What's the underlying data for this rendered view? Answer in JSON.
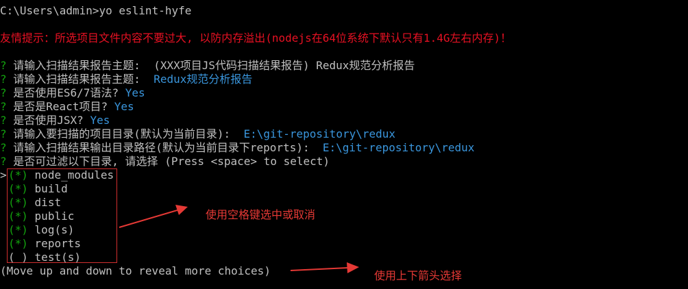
{
  "command": {
    "prompt": "C:\\Users\\admin>",
    "input": "yo eslint-hyfe"
  },
  "warning": "友情提示：所选项目文件内容不要过大, 以防内存溢出(nodejs在64位系统下默认只有1.4G左右内存)！",
  "questions": [
    {
      "mark": "?",
      "question": " 请输入扫描结果报告主题:  ",
      "answer": "(XXX项目JS代码扫描结果报告) Redux规范分析报告",
      "answer_style": "plain"
    },
    {
      "mark": "?",
      "question": " 请输入扫描结果报告主题:  ",
      "answer": "Redux规范分析报告",
      "answer_style": "accent"
    },
    {
      "mark": "?",
      "question": " 是否使用ES6/7语法? ",
      "answer": "Yes",
      "answer_style": "accent"
    },
    {
      "mark": "?",
      "question": " 是否是React项目? ",
      "answer": "Yes",
      "answer_style": "accent"
    },
    {
      "mark": "?",
      "question": " 是否使用JSX? ",
      "answer": "Yes",
      "answer_style": "accent"
    },
    {
      "mark": "?",
      "question": " 请输入要扫描的项目目录(默认为当前目录):  ",
      "answer": "E:\\git-repository\\redux",
      "answer_style": "accent"
    },
    {
      "mark": "?",
      "question": " 请输入扫描结果输出目录路径(默认为当前目录下reports):  ",
      "answer": "E:\\git-repository\\redux",
      "answer_style": "accent"
    },
    {
      "mark": "?",
      "question": " 是否可过滤以下目录, 请选择 ",
      "answer": "(Press <space> to select)",
      "answer_style": "plain"
    }
  ],
  "cursor": ">",
  "choices": [
    {
      "checkbox": "(*)",
      "label": "node_modules",
      "checked": true
    },
    {
      "checkbox": "(*)",
      "label": "build",
      "checked": true
    },
    {
      "checkbox": "(*)",
      "label": "dist",
      "checked": true
    },
    {
      "checkbox": "(*)",
      "label": "public",
      "checked": true
    },
    {
      "checkbox": "(*)",
      "label": "log(s)",
      "checked": true
    },
    {
      "checkbox": "(*)",
      "label": "reports",
      "checked": true
    },
    {
      "checkbox": "( )",
      "label": "test(s)",
      "checked": false
    }
  ],
  "hint": "(Move up and down to reveal more choices)",
  "annotations": {
    "space_select": "使用空格键选中或取消",
    "arrow_select": "使用上下箭头选择"
  },
  "colors": {
    "background": "#000000",
    "text": "#c0c0c0",
    "question_mark": "#13a10e",
    "answer": "#3a96dd",
    "warning": "#e81123",
    "annotation": "#e53935"
  }
}
